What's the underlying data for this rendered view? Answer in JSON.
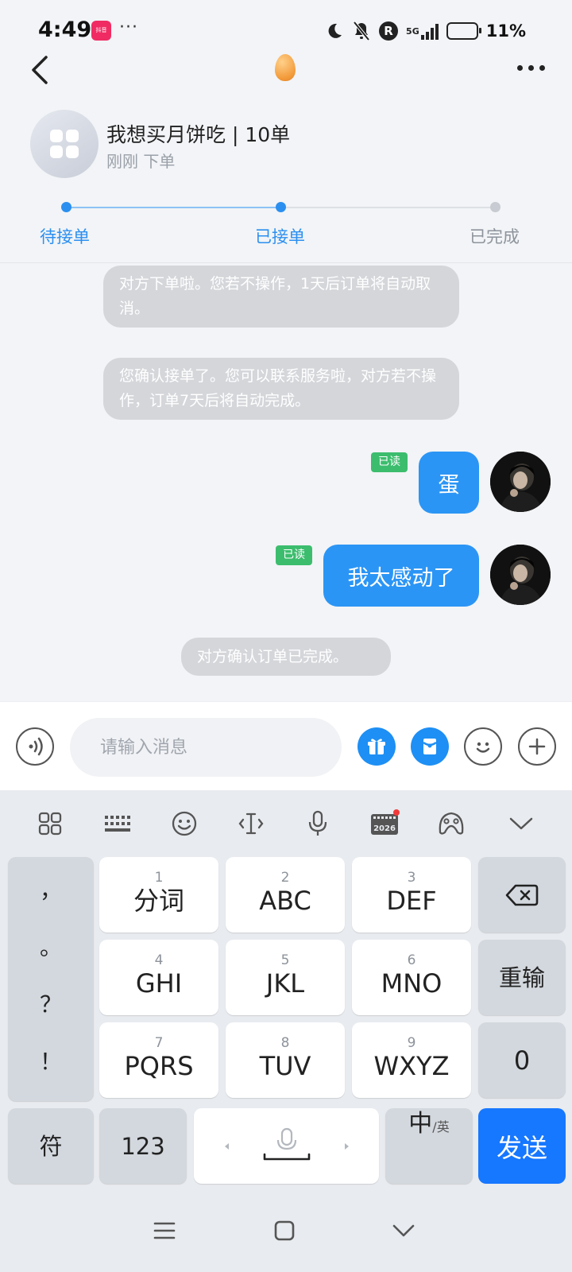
{
  "status_bar": {
    "time": "4:49",
    "app_badge": "抖音",
    "more_indicator": "···",
    "network": "5G",
    "r_badge": "R",
    "battery_percent": "11%",
    "battery_level": 0.11
  },
  "header": {
    "back_icon": "chevron-left-icon",
    "title_icon": "egg-icon",
    "more_icon": "more-horizontal-icon"
  },
  "order": {
    "title": "我想买月饼吃 | 10单",
    "subtitle": "刚刚  下单"
  },
  "progress": {
    "steps": [
      "待接单",
      "已接单",
      "已完成"
    ],
    "current_step_index": 1,
    "active_color": "#2b8ff0",
    "inactive_color": "#c8ccd2"
  },
  "chat": {
    "system_messages": [
      "对方下单啦。您若不操作，1天后订单将自动取消。",
      "您确认接单了。您可以联系服务啦，对方若不操作，订单7天后将自动完成。",
      "对方确认订单已完成。"
    ],
    "messages": [
      {
        "text": "蛋",
        "read_label": "已读"
      },
      {
        "text": "我太感动了",
        "read_label": "已读"
      }
    ]
  },
  "input_bar": {
    "placeholder": "请输入消息",
    "voice_icon": "voice-icon",
    "gift_icon": "gift-icon",
    "redpacket_icon": "red-packet-icon",
    "emoji_icon": "emoji-icon",
    "plus_icon": "plus-icon"
  },
  "keyboard": {
    "toolbar_icons": [
      "apps-grid-icon",
      "keyboard-icon",
      "emoji-icon",
      "cursor-icon",
      "microphone-icon",
      "calendar-2026-icon",
      "skin-icon",
      "collapse-icon"
    ],
    "calendar_year": "2026",
    "punctuation": [
      "，",
      "。",
      "？",
      "！"
    ],
    "rows": [
      [
        {
          "num": "1",
          "label": "分词"
        },
        {
          "num": "2",
          "label": "ABC"
        },
        {
          "num": "3",
          "label": "DEF"
        }
      ],
      [
        {
          "num": "4",
          "label": "GHI"
        },
        {
          "num": "5",
          "label": "JKL"
        },
        {
          "num": "6",
          "label": "MNO"
        }
      ],
      [
        {
          "num": "7",
          "label": "PQRS"
        },
        {
          "num": "8",
          "label": "TUV"
        },
        {
          "num": "9",
          "label": "WXYZ"
        }
      ]
    ],
    "right_keys": {
      "delete_icon": "backspace-icon",
      "reenter": "重输",
      "zero": "0"
    },
    "bottom": {
      "symbols": "符",
      "numbers": "123",
      "lang_main": "中",
      "lang_sub": "/英",
      "send": "发送"
    }
  },
  "nav_bar": {
    "icons": [
      "menu-icon",
      "home-icon",
      "back-icon"
    ]
  }
}
